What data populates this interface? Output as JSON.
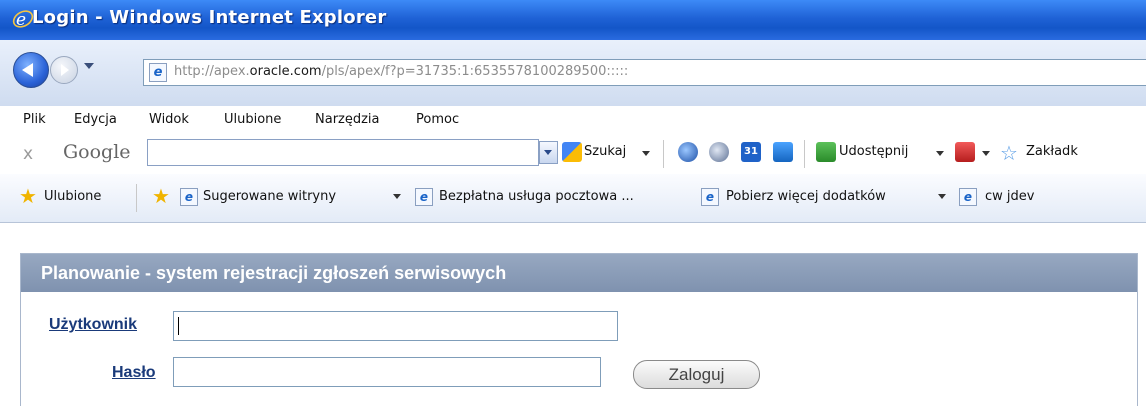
{
  "window": {
    "title": "Login - Windows Internet Explorer"
  },
  "address": {
    "url_prefix": "http://apex.",
    "url_domain": "oracle.com",
    "url_suffix": "/pls/apex/f?p=31735:1:6535578100289500:::::"
  },
  "menu": [
    "Plik",
    "Edycja",
    "Widok",
    "Ulubione",
    "Narzędzia",
    "Pomoc"
  ],
  "google_toolbar": {
    "close": "x",
    "logo": "Google",
    "search_value": "",
    "search_label": "Szukaj",
    "share_label": "Udostępnij",
    "bookmarks_label": "Zakładk"
  },
  "favorites_bar": {
    "favorites_label": "Ulubione",
    "items": [
      "Sugerowane witryny",
      "Bezpłatna usługa pocztowa ...",
      "Pobierz więcej dodatków",
      "cw jdev"
    ]
  },
  "login": {
    "heading": "Planowanie - system rejestracji zgłoszeń serwisowych",
    "username_label": "Użytkownik",
    "username_value": "",
    "password_label": "Hasło",
    "password_value": "",
    "submit_label": "Zaloguj"
  }
}
